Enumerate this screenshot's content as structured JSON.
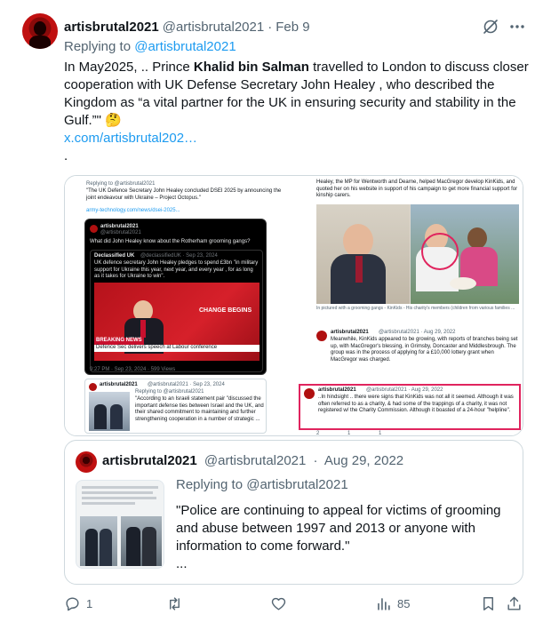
{
  "author": {
    "name": "artisbrutal2021",
    "handle": "@artisbrutal2021",
    "separator": "·",
    "date": "Feb 9"
  },
  "replying": {
    "prefix": "Replying to",
    "target": "@artisbrutal2021"
  },
  "body": {
    "p1": "In May2025, .. Prince ",
    "p1_bold": "Khalid bin Salman",
    "p1_rest": " travelled  to London to discuss closer cooperation with UK Defense Secretary John Healey , who described the Kingdom as “a vital partner for the UK in  ensuring security and stability in the Gulf.”\"  ",
    "emoji": "🤔",
    "link": "x.com/artisbrutal202…",
    "trailing": "."
  },
  "media": {
    "left": {
      "replying": "Replying to @artisbrutal2021",
      "line1": "\"The UK Defence Secretary John Healey concluded DSEI 2025 by announcing the joint endeavour with Ukraine – Project Octopus.\"",
      "link": "army-technology.com/news/dsei-2025...",
      "inner_name": "artisbrutal2021",
      "inner_handle": "@artisbrutal2021",
      "inner_question": "What did John Healey know about the Rotherham grooming gangs?",
      "declassified": "Declassified UK",
      "declassified_handle": "@declassifiedUK · Sep 23, 2024",
      "declassified_text": "UK defence secretary John Healey pledges to spend £3bn \"in military support for Ukraine this year, next year, and every year , for as long as it takes for Ukraine to win\".",
      "breaking": "BREAKING NEWS",
      "ticker": "Defence Sec delivers speech at Labour conference",
      "change": "CHANGE BEGINS",
      "timestamp": "9:27 PM · Sep 23, 2024 · 599 Views",
      "reply_name": "artisbrutal2021",
      "reply_meta": "@artisbrutal2021 · Sep 23, 2024",
      "reply_replying": "Replying to @artisbrutal2021",
      "reply_text": "\"According to an Israeli statement pair \"discussed the important defense  ties between Israel and the UK, and their shared commitment to  maintaining and further strengthening cooperation in a number of  strategic ..."
    },
    "right": {
      "top_text": "Healey, the MP for Wentworth and Dearne, helped MacGregor develop KinKids, and quoted her on his website in support of his campaign to get more financial support for kinship carers.",
      "caption": "In pictured with a grooming gangs - KinKids - His charity's members (children from various families ...",
      "post1_name": "artisbrutal2021",
      "post1_meta": "@artisbrutal2021 · Aug 29, 2022",
      "post1_text": "Meanwhile, KinKids appeared to be growing, with reports of branches being set up, with MacGregor's blessing, in Grimsby, Doncaster and Middlesbrough. The group was in the process of applying for a £10,000 lottery grant when MacGregor was charged.",
      "post2_name": "artisbrutal2021",
      "post2_meta": "@artisbrutal2021 · Aug 29, 2022",
      "post2_text": "..In hindsight .. there were signs that KinKids was not all it seemed. Although it was often referred to as a charity, & had some of the trappings of a charity, it was not registered w/ the Charity Commission. Although it boasted of a 24-hour \"helpline\".",
      "counts": [
        "2",
        "1",
        "1"
      ]
    }
  },
  "quote": {
    "name": "artisbrutal2021",
    "handle": "@artisbrutal2021",
    "separator": "·",
    "date": "Aug 29, 2022",
    "replying": "Replying to @artisbrutal2021",
    "text": "\"Police are continuing to appeal for victims of grooming and abuse between 1997 and 2013 or anyone with information to come forward.\"",
    "ellipsis": "..."
  },
  "actions": {
    "reply_count": "1",
    "retweet_count": "",
    "like_count": "",
    "views_count": "85"
  },
  "colors": {
    "link": "#1d9bf0",
    "secondary": "#536471",
    "border": "#cfd9de",
    "highlight": "#e0245e"
  }
}
